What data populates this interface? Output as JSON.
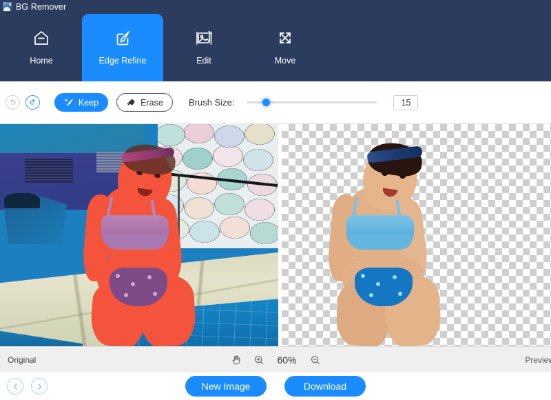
{
  "window": {
    "title": "BG Remover",
    "app_icon": "app-photo-icon"
  },
  "nav": {
    "tabs": [
      {
        "label": "Home",
        "icon": "home-icon",
        "active": false
      },
      {
        "label": "Edge Refine",
        "icon": "edge-refine-icon",
        "active": true
      },
      {
        "label": "Edit",
        "icon": "image-edit-icon",
        "active": false
      },
      {
        "label": "Move",
        "icon": "move-arrows-icon",
        "active": false
      }
    ]
  },
  "toolbar": {
    "undo_icon": "undo-arrow-icon",
    "redo_icon": "redo-arrow-icon",
    "keep_label": "Keep",
    "keep_icon": "brush-sparkle-icon",
    "erase_label": "Erase",
    "erase_icon": "eraser-icon",
    "brush_size_label": "Brush Size:",
    "brush_size_value": "15",
    "brush_size_percent": 15
  },
  "canvas": {
    "left_caption": "Original",
    "right_caption": "Preview"
  },
  "status": {
    "hand_icon": "hand-tool-icon",
    "zoom_in_icon": "zoom-in-icon",
    "zoom_level": "60%",
    "zoom_out_icon": "zoom-out-icon"
  },
  "actions": {
    "prev_icon": "chevron-left-icon",
    "next_icon": "chevron-right-icon",
    "new_image_label": "New Image",
    "download_label": "Download"
  },
  "colors": {
    "header_bg": "#2b3c5e",
    "accent_blue": "#1a8cff",
    "selection_red": "#f4543c",
    "statusbar_bg": "#efefef"
  }
}
